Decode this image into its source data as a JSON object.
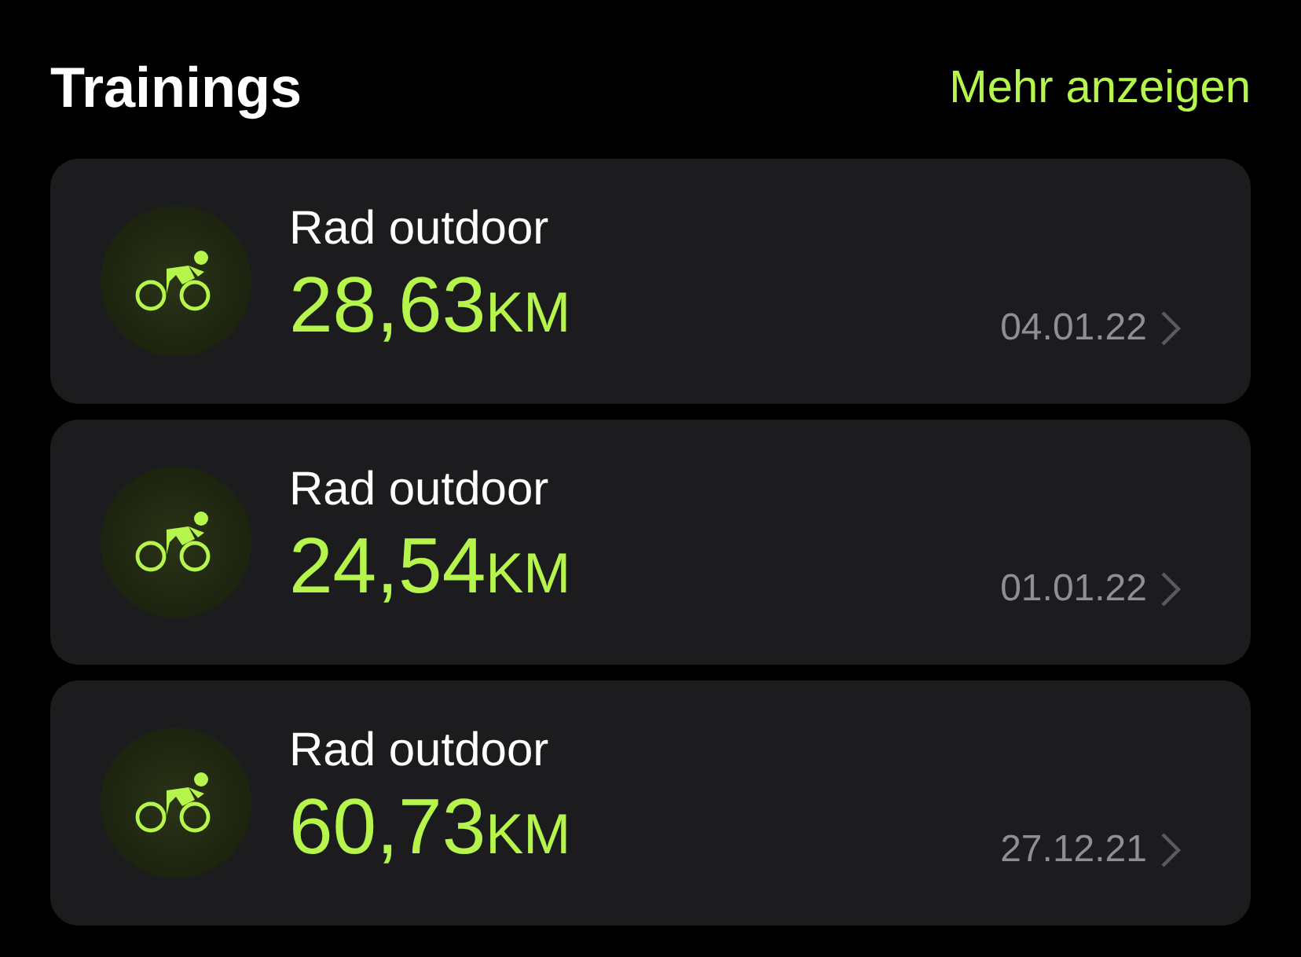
{
  "header": {
    "title": "Trainings",
    "link": "Mehr anzeigen"
  },
  "workouts": [
    {
      "name": "Rad outdoor",
      "value": "28,63",
      "unit": "KM",
      "date": "04.01.22"
    },
    {
      "name": "Rad outdoor",
      "value": "24,54",
      "unit": "KM",
      "date": "01.01.22"
    },
    {
      "name": "Rad outdoor",
      "value": "60,73",
      "unit": "KM",
      "date": "27.12.21"
    }
  ]
}
